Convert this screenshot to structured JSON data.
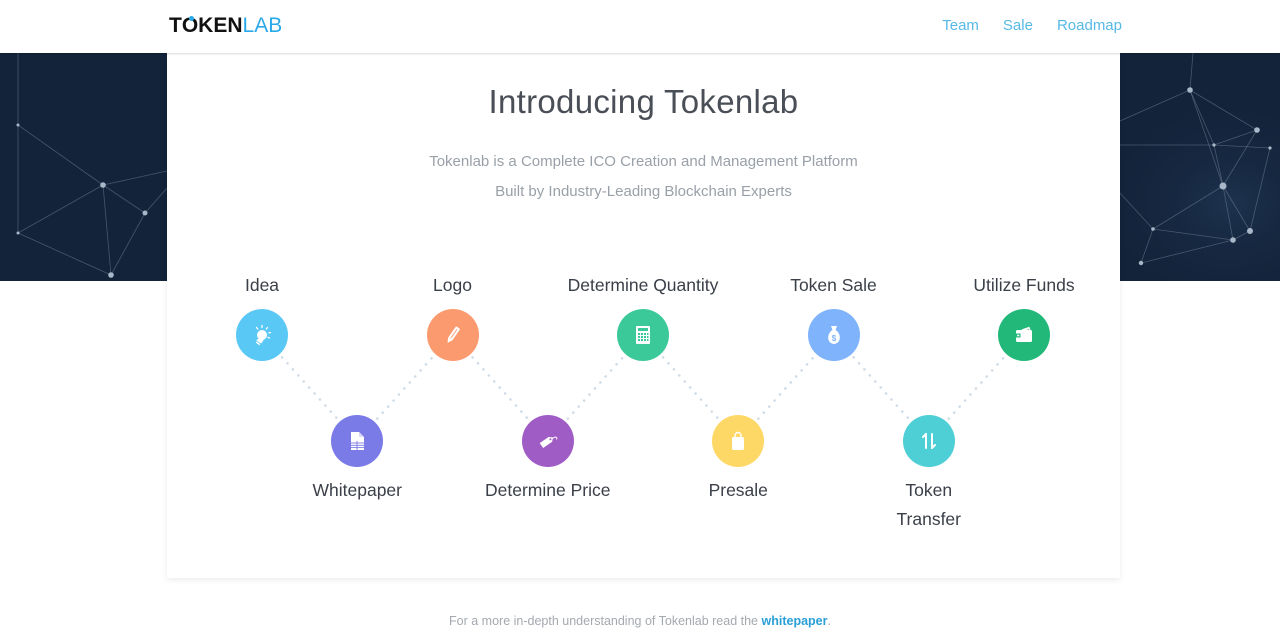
{
  "brand": {
    "logo_part1": "T",
    "logo_part2": "KEN",
    "logo_part3": "LAB",
    "accent": "#2aa9e8"
  },
  "nav": {
    "items": [
      {
        "label": "Team"
      },
      {
        "label": "Sale"
      },
      {
        "label": "Roadmap"
      }
    ]
  },
  "intro": {
    "title": "Introducing Tokenlab",
    "subtitle_line1": "Tokenlab is a Complete ICO Creation and Management Platform",
    "subtitle_line2": "Built by Industry-Leading Blockchain Experts"
  },
  "steps": [
    {
      "label": "Idea",
      "icon": "lightbulb-icon",
      "color": "#5ac8f5",
      "row": "top"
    },
    {
      "label": "Whitepaper",
      "icon": "document-icon",
      "color": "#7b7be8",
      "row": "bottom"
    },
    {
      "label": "Logo",
      "icon": "pencil-icon",
      "color": "#fc9a6f",
      "row": "top"
    },
    {
      "label": "Determine Price",
      "icon": "price-tag-icon",
      "color": "#a05cc5",
      "row": "bottom"
    },
    {
      "label": "Determine Quantity",
      "icon": "calculator-icon",
      "color": "#3cc99a",
      "row": "top"
    },
    {
      "label": "Presale",
      "icon": "shopping-bag-icon",
      "color": "#fed866",
      "row": "bottom"
    },
    {
      "label": "Token Sale",
      "icon": "money-bag-icon",
      "color": "#7fb3fb",
      "row": "top"
    },
    {
      "label": "Token Transfer",
      "label_line1": "Token",
      "label_line2": "Transfer",
      "icon": "transfer-arrows-icon",
      "color": "#4ecfd6",
      "row": "bottom"
    },
    {
      "label": "Utilize Funds",
      "icon": "wallet-icon",
      "color": "#22b87a",
      "row": "top"
    }
  ],
  "footer": {
    "text": "For a more in-depth understanding of Tokenlab read the ",
    "link_label": "whitepaper",
    "suffix": "."
  }
}
